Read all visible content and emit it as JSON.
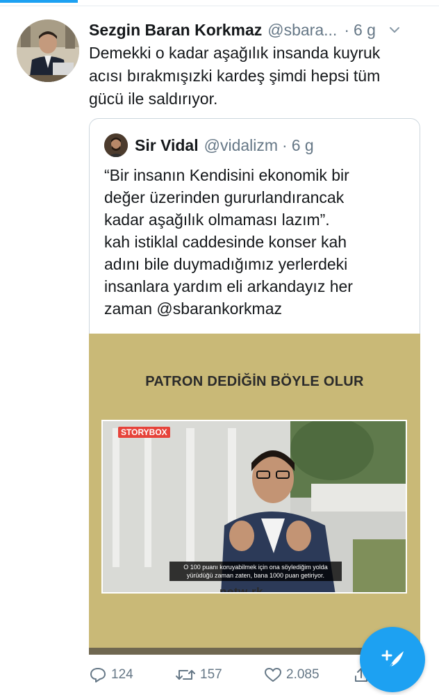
{
  "tweet": {
    "author_name": "Sezgin Baran Korkmaz",
    "author_handle": "@sbara...",
    "dot": "·",
    "time": "6 g",
    "text_lines": [
      "Demekki o kadar aşağılık insanda kuyruk",
      "acısı bırakmışızki kardeş şimdi hepsi tüm",
      "gücü ile saldırıyor."
    ]
  },
  "quote": {
    "author_name": "Sir Vidal",
    "author_handle": "@vidalizm",
    "dot": "·",
    "time": "6 g",
    "text_lines": [
      "“Bir insanın Kendisini ekonomik bir",
      "değer üzerinden gururlandırancak",
      "kadar aşağılık olmaması lazım”.",
      "kah istiklal caddesinde konser kah",
      "adını bile duymadığımız yerlerdeki",
      "insanlara yardım eli arkandayız her",
      "zaman @sbarankorkmaz"
    ],
    "video": {
      "banner": "PATRON DEDİĞİN BÖYLE OLUR",
      "overlay_logo": "STORYBOX",
      "subtitle_lines": [
        "O 100 puanı koruyabilmek için ona söylediğim yolda",
        "yürüdüğü zaman zaten, bana 1000 puan getiriyor."
      ],
      "watermark": "netw rk"
    }
  },
  "actions": {
    "reply_count": "124",
    "retweet_count": "157",
    "like_count": "2.085"
  },
  "icons": {
    "chevron": "chevron-down-icon",
    "reply": "reply-icon",
    "retweet": "retweet-icon",
    "like": "heart-icon",
    "share": "share-icon",
    "compose": "compose-tweet-icon"
  },
  "colors": {
    "accent": "#1da1f2",
    "text": "#14171a",
    "secondary": "#657786",
    "border": "#ccd6dd",
    "video_bg": "#c9b977"
  }
}
